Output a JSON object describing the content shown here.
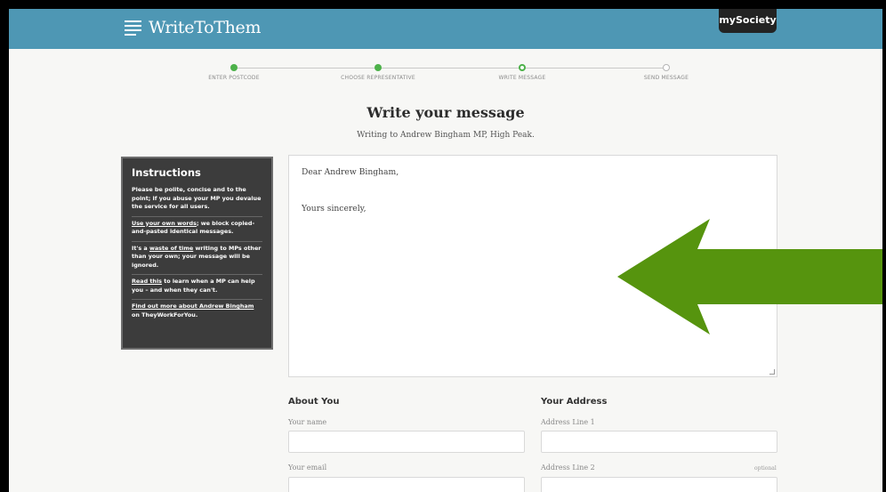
{
  "header": {
    "logo_text": "WriteToThem",
    "badge": "mySociety",
    "colors": {
      "bar": "#4e97b4",
      "badge": "#232323"
    }
  },
  "steps": [
    {
      "label": "ENTER POSTCODE",
      "state": "done"
    },
    {
      "label": "CHOOSE REPRESENTATIVE",
      "state": "done"
    },
    {
      "label": "WRITE MESSAGE",
      "state": "current"
    },
    {
      "label": "SEND MESSAGE",
      "state": "todo"
    }
  ],
  "page": {
    "title": "Write your message",
    "subtitle": "Writing to Andrew Bingham MP, High Peak."
  },
  "instructions": {
    "heading": "Instructions",
    "intro": "Please be polite, concise and to the point; if you abuse your MP you devalue the service for all users.",
    "tip_own_words_link": "Use your own words",
    "tip_own_words_rest": "; we block copied-and-pasted identical messages.",
    "tip_waste_pre": "It's a ",
    "tip_waste_link": "waste of time",
    "tip_waste_post": " writing to MPs other than your own; your message will be ignored.",
    "tip_read_link": "Read this",
    "tip_read_rest": " to learn when a MP can help you – and when they can't.",
    "tip_find_link": "Find out more about Andrew Bingham",
    "tip_find_rest": " on TheyWorkForYou."
  },
  "message": {
    "greeting": "Dear Andrew Bingham,",
    "closing": "Yours sincerely,"
  },
  "about": {
    "title": "About You",
    "name_label": "Your name",
    "email_label": "Your email"
  },
  "address": {
    "title": "Your Address",
    "line1_label": "Address Line 1",
    "line2_label": "Address Line 2",
    "optional": "optional"
  },
  "annotation": {
    "arrow_color": "#56940e"
  }
}
